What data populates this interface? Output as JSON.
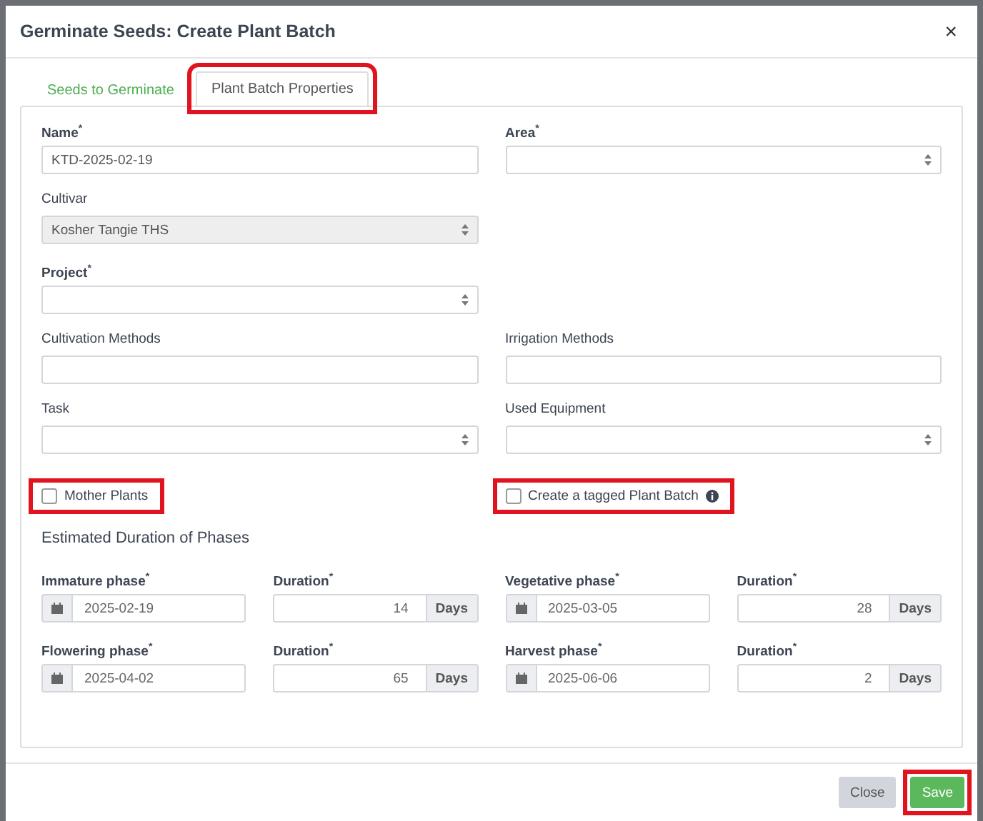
{
  "dialog": {
    "title": "Germinate Seeds: Create Plant Batch",
    "close_label": "×"
  },
  "tabs": [
    {
      "label": "Seeds to Germinate",
      "selected": false,
      "highlighted": false
    },
    {
      "label": "Plant Batch Properties",
      "selected": true,
      "highlighted": true
    }
  ],
  "rows": [
    {
      "cells": [
        {
          "kind": "text",
          "label": "Name",
          "mark": "*",
          "value": "KTD-2025-02-19",
          "disabled": false
        },
        {
          "kind": "select",
          "label": "Area",
          "mark": "*",
          "disabled": false
        }
      ]
    },
    {
      "cells": [
        {
          "kind": "select",
          "label": "Cultivar",
          "value": "Kosher Tangie THS",
          "disabled": true
        }
      ]
    },
    {
      "cells": [
        {
          "kind": "select",
          "label": "Project",
          "mark": "*",
          "disabled": false
        }
      ]
    },
    {
      "cells": [
        {
          "kind": "text",
          "label": "Cultivation Methods",
          "disabled": false
        },
        {
          "kind": "text",
          "label": "Irrigation Methods",
          "disabled": false
        }
      ]
    },
    {
      "cells": [
        {
          "kind": "select",
          "label": "Task",
          "disabled": false
        },
        {
          "kind": "select",
          "label": "Used Equipment",
          "disabled": false
        }
      ]
    },
    {
      "cells": [
        {
          "kind": "checkbox",
          "label": "Mother Plants",
          "checked": false,
          "info": false,
          "highlighted": true
        },
        {
          "kind": "checkbox",
          "label": "Create a tagged Plant Batch",
          "checked": false,
          "info": true,
          "highlighted": true
        }
      ]
    }
  ],
  "phases_heading": "Estimated Duration of Phases",
  "phases": [
    {
      "label": "Immature phase",
      "mark": "*",
      "date": "2025-02-19",
      "duration_label": "Duration",
      "duration_mark": "*",
      "duration": "14",
      "unit": "Days"
    },
    {
      "label": "Vegetative phase",
      "mark": "*",
      "date": "2025-03-05",
      "duration_label": "Duration",
      "duration_mark": "*",
      "duration": "28",
      "unit": "Days"
    },
    {
      "label": "Flowering phase",
      "mark": "*",
      "date": "2025-04-02",
      "duration_label": "Duration",
      "duration_mark": "*",
      "duration": "65",
      "unit": "Days"
    },
    {
      "label": "Harvest phase",
      "mark": "*",
      "date": "2025-06-06",
      "duration_label": "Duration",
      "duration_mark": "*",
      "duration": "2",
      "unit": "Days"
    }
  ],
  "footer_buttons": [
    {
      "label": "Close",
      "kind": "secondary",
      "highlighted": false
    },
    {
      "label": "Save",
      "kind": "primary",
      "highlighted": true
    }
  ]
}
